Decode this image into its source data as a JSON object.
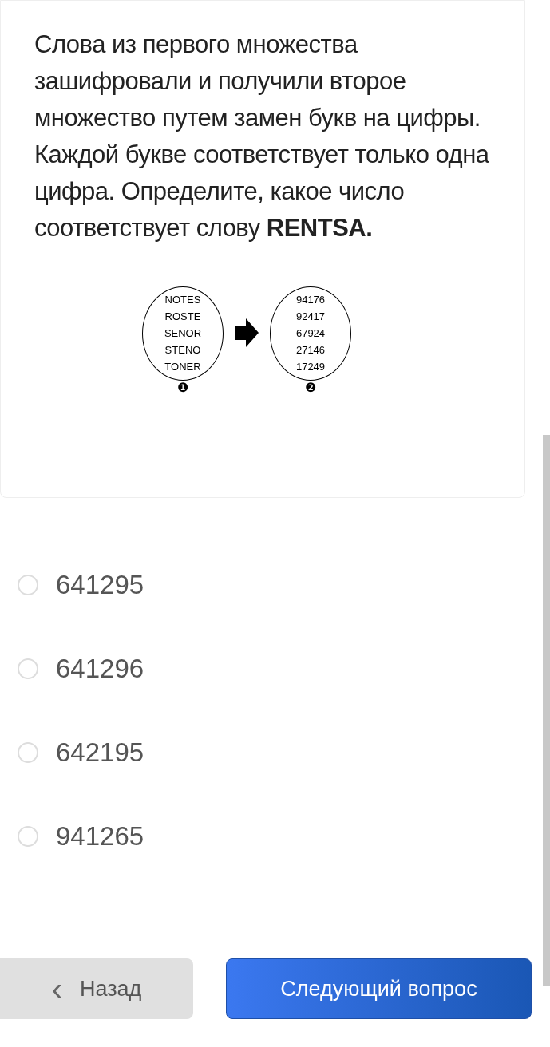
{
  "question": {
    "text": "Слова из первого множества зашифровали и получили второе множество путем замен букв на цифры. Каждой букве соответствует только одна цифра. Определите, какое число соответствует слову **RENTSA.**"
  },
  "diagram": {
    "sets": [
      {
        "items": [
          "NOTES",
          "ROSTE",
          "SENOR",
          "STENO",
          "TONER"
        ],
        "label": "❶"
      },
      {
        "items": [
          "94176",
          "92417",
          "67924",
          "27146",
          "17249"
        ],
        "label": "❷"
      }
    ]
  },
  "options": [
    {
      "label": "641295",
      "selected": false
    },
    {
      "label": "641296",
      "selected": false
    },
    {
      "label": "642195",
      "selected": false
    },
    {
      "label": "941265",
      "selected": false
    }
  ],
  "buttons": {
    "back": {
      "icon": "‹",
      "label": "Назад"
    },
    "next": {
      "label": "Следующий вопрос"
    }
  }
}
